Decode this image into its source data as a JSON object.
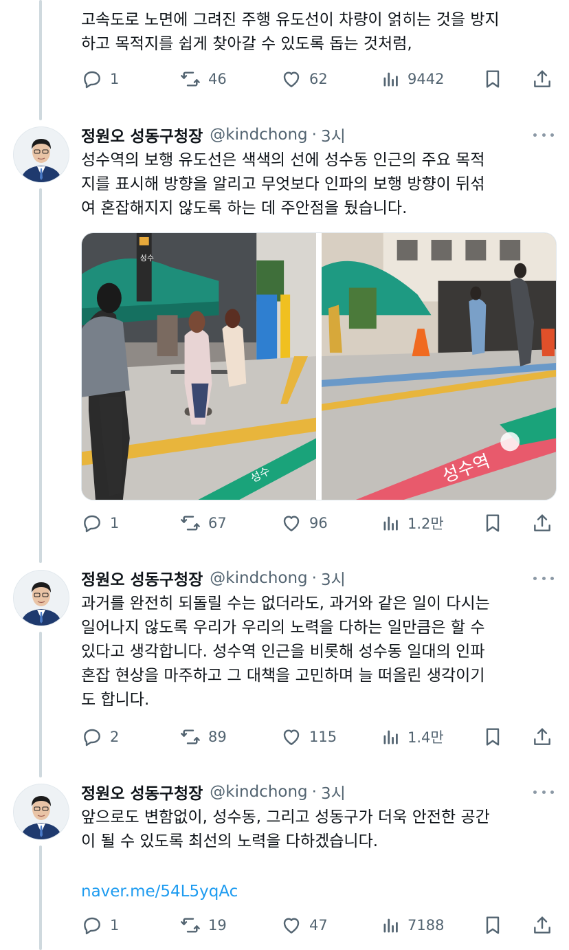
{
  "tweets": [
    {
      "text_lines": [
        "고속도로 노면에 그려진 주행 유도선이 차량이 얽히는 것을 방지",
        "하고 목적지를 쉽게 찾아갈 수 있도록 돕는 것처럼,"
      ],
      "replies": "1",
      "retweets": "46",
      "likes": "62",
      "views": "9442"
    },
    {
      "name": "정원오 성동구청장",
      "handle": "@kindchong",
      "time": "3시",
      "text_lines": [
        "성수역의 보행 유도선은 색색의 선에 성수동 인근의 주요 목적",
        "지를 표시해 방향을 알리고 무엇보다 인파의 보행 방향이 뒤섞",
        "여 혼잡해지지 않도록 하는 데 주안점을 뒀습니다."
      ],
      "replies": "1",
      "retweets": "67",
      "likes": "96",
      "views": "1.2만"
    },
    {
      "name": "정원오 성동구청장",
      "handle": "@kindchong",
      "time": "3시",
      "text_lines": [
        "과거를 완전히 되돌릴 수는 없더라도, 과거와 같은 일이 다시는",
        "일어나지 않도록 우리가 우리의 노력을 다하는 일만큼은 할 수",
        "있다고 생각합니다. 성수역 인근을 비롯해 성수동 일대의 인파",
        "혼잡 현상을 마주하고 그 대책을 고민하며 늘 떠올린 생각이기",
        "도 합니다."
      ],
      "replies": "2",
      "retweets": "89",
      "likes": "115",
      "views": "1.4만"
    },
    {
      "name": "정원오 성동구청장",
      "handle": "@kindchong",
      "time": "3시",
      "text_lines": [
        "앞으로도 변함없이, 성수동, 그리고 성동구가 더욱 안전한 공간",
        "이 될 수 있도록 최선의 노력을 다하겠습니다."
      ],
      "link": "naver.me/54L5yqAc",
      "replies": "1",
      "retweets": "19",
      "likes": "47",
      "views": "7188"
    }
  ],
  "signage": {
    "floor_sign_left": "성수",
    "floor_sign_right": "성수역",
    "pillar_sign": "성수"
  },
  "colors": {
    "link": "#1d9bf0",
    "secondary": "#536471",
    "thread_line": "#cfd9de",
    "green_line": "#1aa37a",
    "yellow_line": "#e8b53c",
    "red_line": "#e85a6c"
  },
  "icons": {
    "reply": "speech-bubble-icon",
    "retweet": "retweet-arrows-icon",
    "like": "heart-icon",
    "views": "bar-chart-icon",
    "bookmark": "bookmark-icon",
    "share": "share-upload-icon",
    "more": "ellipsis-icon"
  }
}
